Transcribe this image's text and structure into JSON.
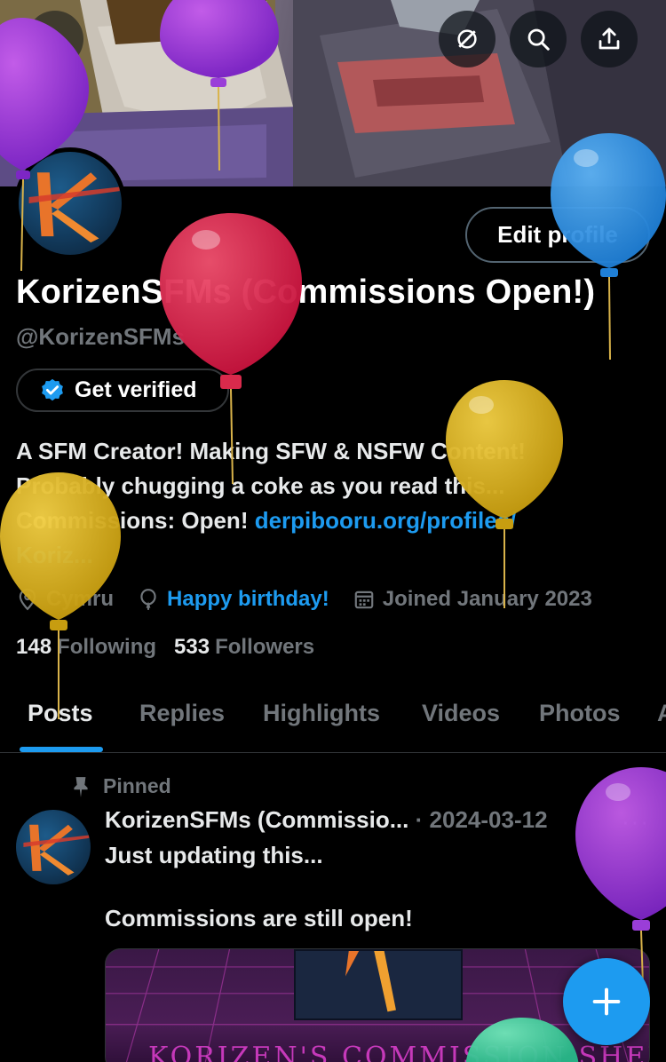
{
  "header": {
    "back_icon": "back-arrow-icon",
    "grok_icon": "grok-icon",
    "search_icon": "search-icon",
    "share_icon": "share-icon"
  },
  "profile": {
    "edit_label": "Edit profile",
    "display_name": "KorizenSFMs (Commissions Open!)",
    "handle": "@KorizenSFMs",
    "verify_label": "Get verified",
    "bio_line1": "A SFM Creator! Making SFW & NSFW Content!",
    "bio_line2": "Probably chugging a coke as you read this...",
    "bio_line3_prefix": "Commissions: Open! ",
    "bio_link": "derpibooru.org/profiles/",
    "bio_line4": "Koriz...",
    "location": "Cymru",
    "birthday": "Happy birthday!",
    "joined": "Joined January 2023",
    "following_count": "148",
    "following_label": "Following",
    "followers_count": "533",
    "followers_label": "Followers"
  },
  "tabs": [
    "Posts",
    "Replies",
    "Highlights",
    "Videos",
    "Photos",
    "A"
  ],
  "post": {
    "pinned_label": "Pinned",
    "author": "KorizenSFMs (Commissio...",
    "separator": "·",
    "date": "2024-03-12",
    "more": "···",
    "line1": "Just updating this...",
    "line2": "Commissions are still open!",
    "media_title": "KORIZEN'S COMMISSION SHEET"
  },
  "colors": {
    "accent": "#1d9bf0",
    "background": "#000000",
    "muted": "#71767b"
  },
  "icons": {
    "fab": "compose-plus-icon",
    "location": "location-pin-icon",
    "birthday": "balloon-icon",
    "joined": "calendar-icon",
    "pin": "pin-icon",
    "verified": "verified-badge-icon"
  }
}
